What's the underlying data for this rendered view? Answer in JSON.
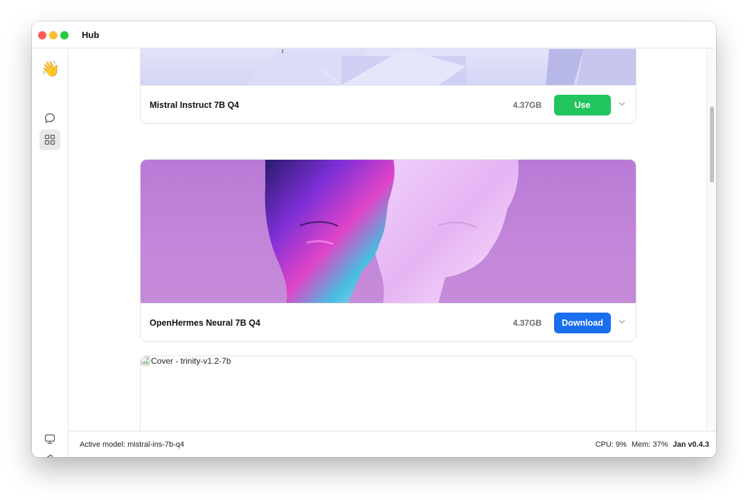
{
  "window": {
    "title": "Hub"
  },
  "sidebar": {
    "logo": "👋",
    "items": [
      {
        "name": "chat",
        "icon": "chat-bubble-icon"
      },
      {
        "name": "hub",
        "icon": "grid-icon",
        "active": true
      },
      {
        "name": "system-monitor",
        "icon": "monitor-icon"
      },
      {
        "name": "settings",
        "icon": "gear-icon"
      }
    ]
  },
  "models": [
    {
      "name": "Mistral Instruct 7B Q4",
      "size": "4.37GB",
      "action": "Use",
      "action_color": "#22c55e"
    },
    {
      "name": "OpenHermes Neural 7B Q4",
      "size": "4.37GB",
      "action": "Download",
      "action_color": "#1a6ef0"
    },
    {
      "cover_alt": "Cover - trinity-v1.2-7b"
    }
  ],
  "status": {
    "active_model": "Active model: mistral-ins-7b-q4",
    "cpu": "CPU: 9%",
    "mem": "Mem: 37%",
    "version": "Jan v0.4.3"
  }
}
